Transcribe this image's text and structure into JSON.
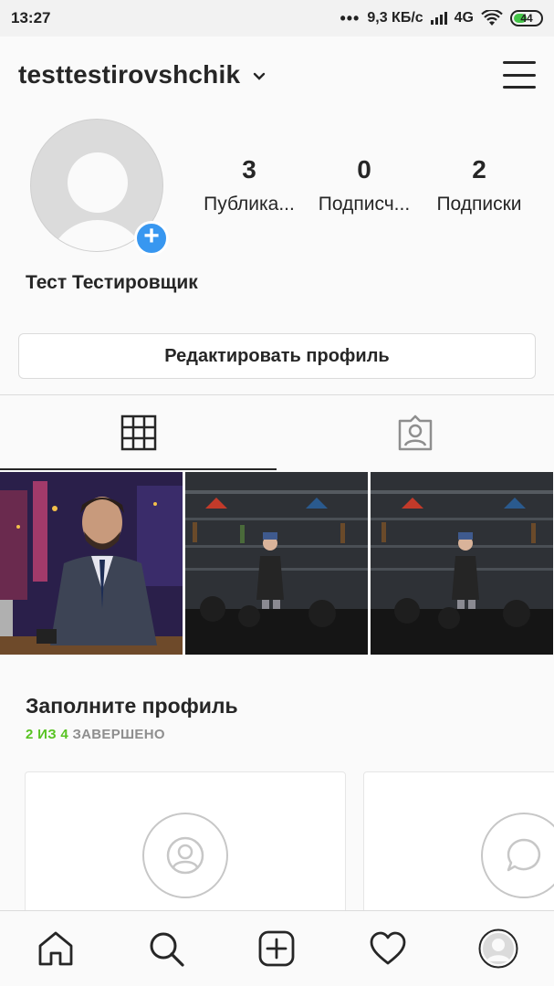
{
  "status_bar": {
    "time": "13:27",
    "dots": "•••",
    "network_speed": "9,3 КБ/с",
    "network_type": "4G",
    "battery_level": "44",
    "battery_color": "#44c548"
  },
  "header": {
    "username": "testtestirovshchik",
    "username_dropdown_icon": "chevron-down-icon",
    "menu_icon": "hamburger-menu-icon"
  },
  "profile": {
    "full_name": "Тест Тестировщик",
    "avatar_icon": "default-avatar-icon",
    "add_photo_icon": "plus-icon",
    "stats": [
      {
        "value": "3",
        "label": "Публика..."
      },
      {
        "value": "0",
        "label": "Подписч..."
      },
      {
        "value": "2",
        "label": "Подписки"
      }
    ],
    "edit_button_label": "Редактировать профиль"
  },
  "tabs": [
    {
      "icon": "grid-icon",
      "active": true
    },
    {
      "icon": "tagged-user-icon",
      "active": false
    }
  ],
  "posts": [
    {
      "thumbnail": "talk-show-host-at-desk"
    },
    {
      "thumbnail": "standup-comedian-on-stage"
    },
    {
      "thumbnail": "standup-comedian-on-stage"
    }
  ],
  "complete_profile": {
    "title": "Заполните профиль",
    "progress_count": "2 ИЗ 4",
    "progress_label": "ЗАВЕРШЕНО",
    "progress_color": "#58c322",
    "cards": [
      {
        "icon": "user-circle-icon"
      },
      {
        "icon": "speech-bubble-icon"
      }
    ]
  },
  "bottom_nav": [
    {
      "icon": "home-icon"
    },
    {
      "icon": "search-icon"
    },
    {
      "icon": "add-post-icon"
    },
    {
      "icon": "heart-icon"
    },
    {
      "icon": "profile-avatar-icon",
      "active": true
    }
  ]
}
